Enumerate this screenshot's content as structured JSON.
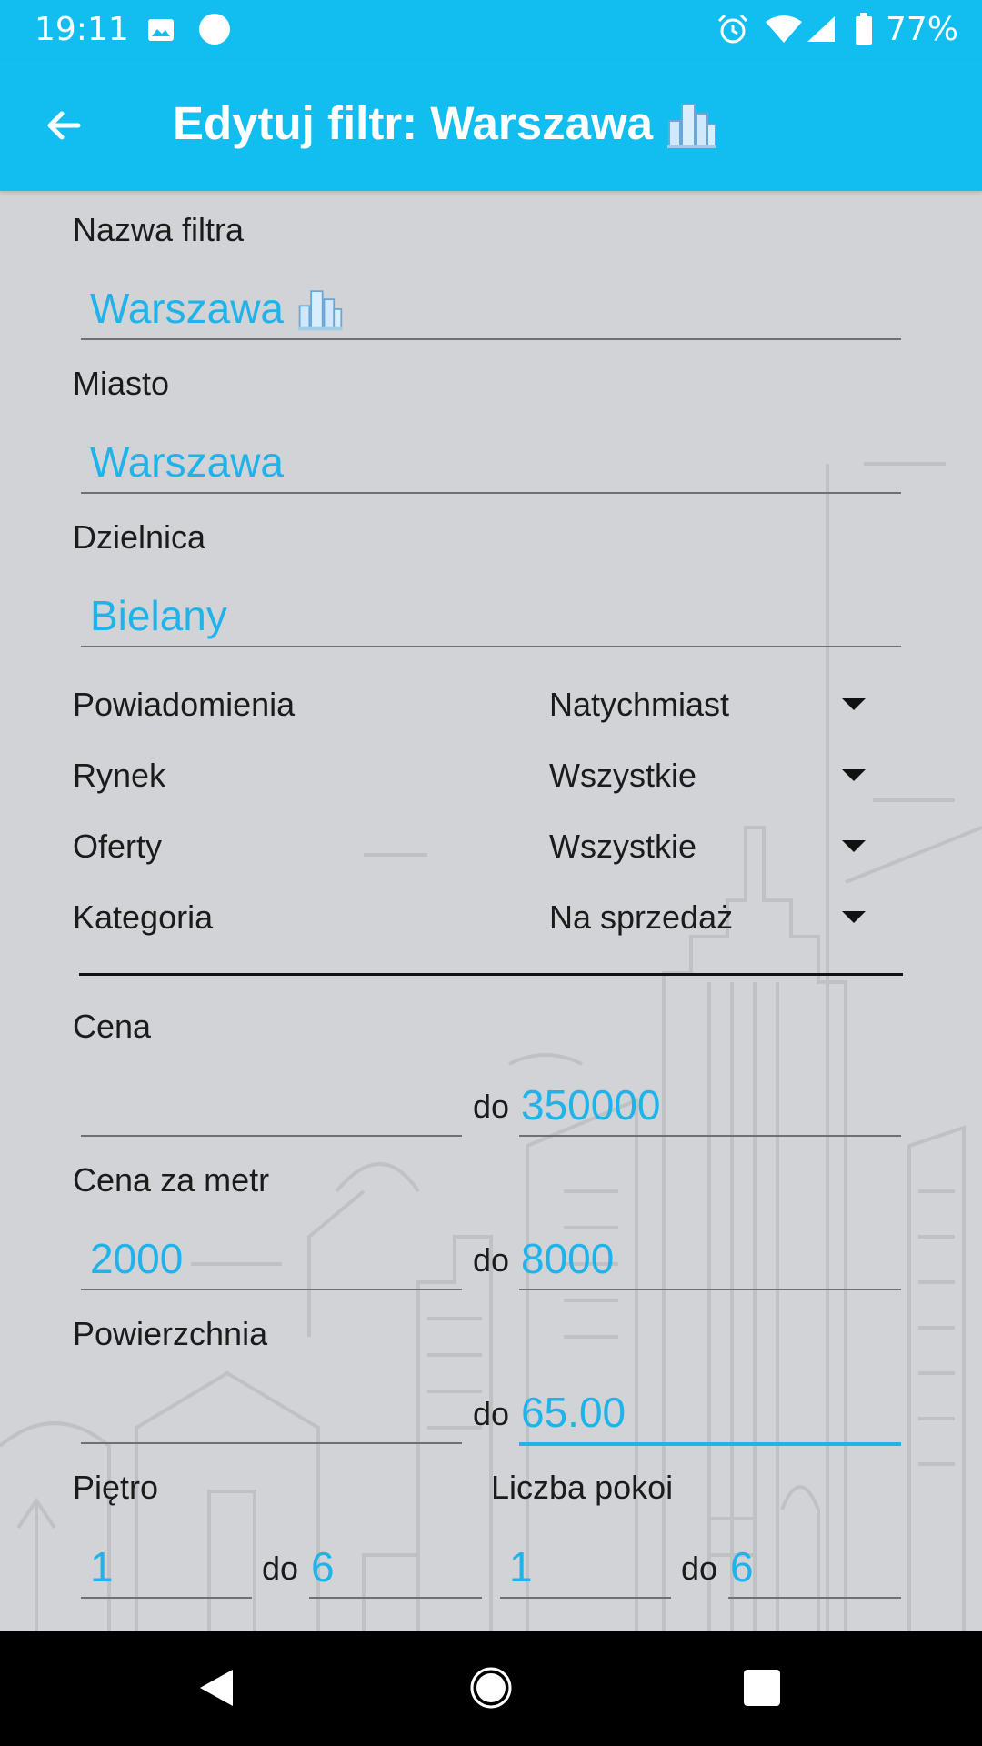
{
  "status_bar": {
    "time": "19:11",
    "battery": "77%"
  },
  "app_bar": {
    "title": "Edytuj filtr: Warszawa"
  },
  "form": {
    "filter_name": {
      "label": "Nazwa filtra",
      "value": "Warszawa"
    },
    "city": {
      "label": "Miasto",
      "value": "Warszawa"
    },
    "district": {
      "label": "Dzielnica",
      "value": "Bielany"
    },
    "notifications": {
      "label": "Powiadomienia",
      "value": "Natychmiast"
    },
    "market": {
      "label": "Rynek",
      "value": "Wszystkie"
    },
    "offers": {
      "label": "Oferty",
      "value": "Wszystkie"
    },
    "category": {
      "label": "Kategoria",
      "value": "Na sprzedaż"
    },
    "price": {
      "label": "Cena",
      "from": "",
      "to_label": "do",
      "to": "350000"
    },
    "price_per_meter": {
      "label": "Cena za metr",
      "from": "2000",
      "to_label": "do",
      "to": "8000"
    },
    "area": {
      "label": "Powierzchnia",
      "from": "",
      "to_label": "do",
      "to": "65.00"
    },
    "floor": {
      "label": "Piętro",
      "from": "1",
      "to_label": "do",
      "to": "6"
    },
    "rooms": {
      "label": "Liczba pokoi",
      "from": "1",
      "to_label": "do",
      "to": "6"
    }
  },
  "colors": {
    "accent": "#12bef0",
    "value_text": "#1fb3ea",
    "background": "#d1d3d6"
  }
}
